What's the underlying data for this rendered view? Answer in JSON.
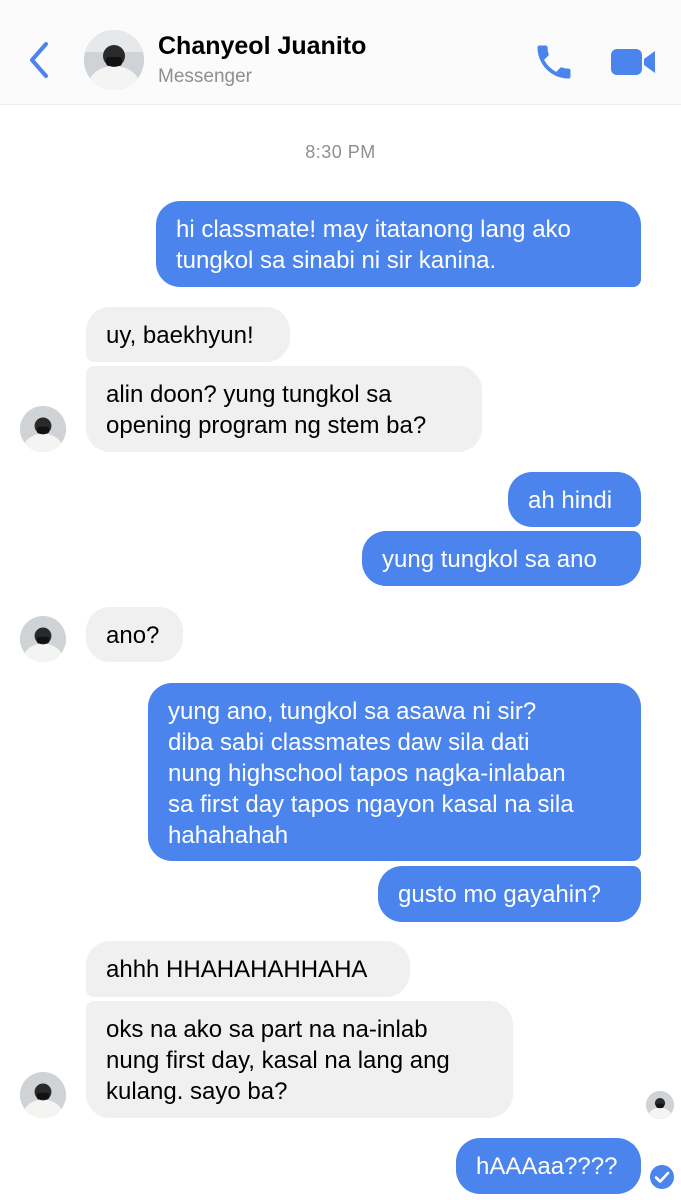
{
  "header": {
    "back_icon": "chevron-left-icon",
    "contact_name": "Chanyeol Juanito",
    "subtitle": "Messenger",
    "call_icon": "phone-icon",
    "video_icon": "video-camera-icon",
    "accent_color": "#4a84ec"
  },
  "timestamp": "8:30 PM",
  "messages": [
    {
      "from": "me",
      "text": "hi classmate! may itatanong lang ako\ntungkol sa sinabi ni sir kanina."
    },
    {
      "from": "them",
      "text": "uy, baekhyun!"
    },
    {
      "from": "them",
      "text": "alin doon? yung tungkol sa\nopening program ng stem ba?"
    },
    {
      "from": "me",
      "text": "ah hindi"
    },
    {
      "from": "me",
      "text": "yung tungkol sa ano"
    },
    {
      "from": "them",
      "text": "ano?"
    },
    {
      "from": "me",
      "text": "yung ano, tungkol sa asawa ni sir?\ndiba sabi classmates daw sila dati\nnung highschool tapos nagka-inlaban\nsa first day tapos ngayon kasal na sila\nhahahahah"
    },
    {
      "from": "me",
      "text": "gusto mo gayahin?"
    },
    {
      "from": "them",
      "text": "ahhh HHAHAHAHHAHA"
    },
    {
      "from": "them",
      "text": "oks na ako sa part na na-inlab\nnung first day, kasal na lang ang\nkulang. sayo ba?"
    },
    {
      "from": "me",
      "text": "hAAAaa????"
    }
  ],
  "colors": {
    "outgoing_bubble": "#4a84ec",
    "incoming_bubble": "#f0f0f0"
  },
  "status_icon": "seen-check-icon"
}
